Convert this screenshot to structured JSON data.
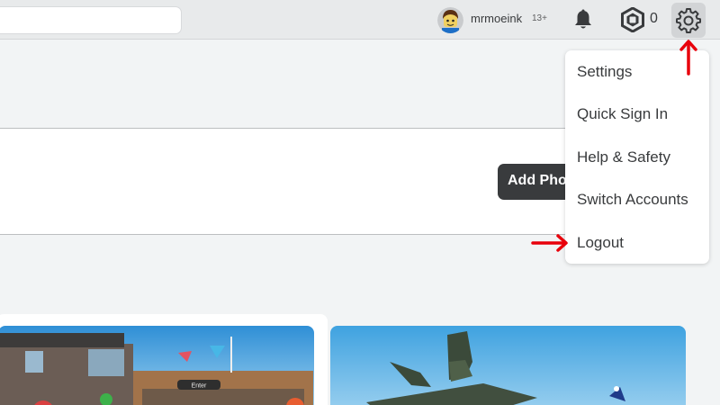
{
  "header": {
    "search": {
      "placeholder": ""
    },
    "user": {
      "name": "mrmoeink",
      "age_badge": "13+",
      "avatar": "avatar-icon"
    },
    "notifications": {
      "icon": "bell-icon"
    },
    "robux": {
      "icon": "robux-icon",
      "count": "0"
    },
    "settings": {
      "icon": "gear-icon"
    }
  },
  "main": {
    "add_photo_label": "Add Photo"
  },
  "dropdown": {
    "items": [
      {
        "label": "Settings"
      },
      {
        "label": "Quick Sign In"
      },
      {
        "label": "Help & Safety"
      },
      {
        "label": "Switch Accounts"
      },
      {
        "label": "Logout"
      }
    ]
  },
  "games": [
    {
      "thumbnail": "game-thumbnail-obby",
      "sign_text": "Enter"
    },
    {
      "thumbnail": "game-thumbnail-plane"
    }
  ],
  "annotations": {
    "arrow_color": "#e8000b"
  },
  "colors": {
    "topbar": "#e8eaeb",
    "dark_button": "#393b3d",
    "text": "#393b3d"
  }
}
